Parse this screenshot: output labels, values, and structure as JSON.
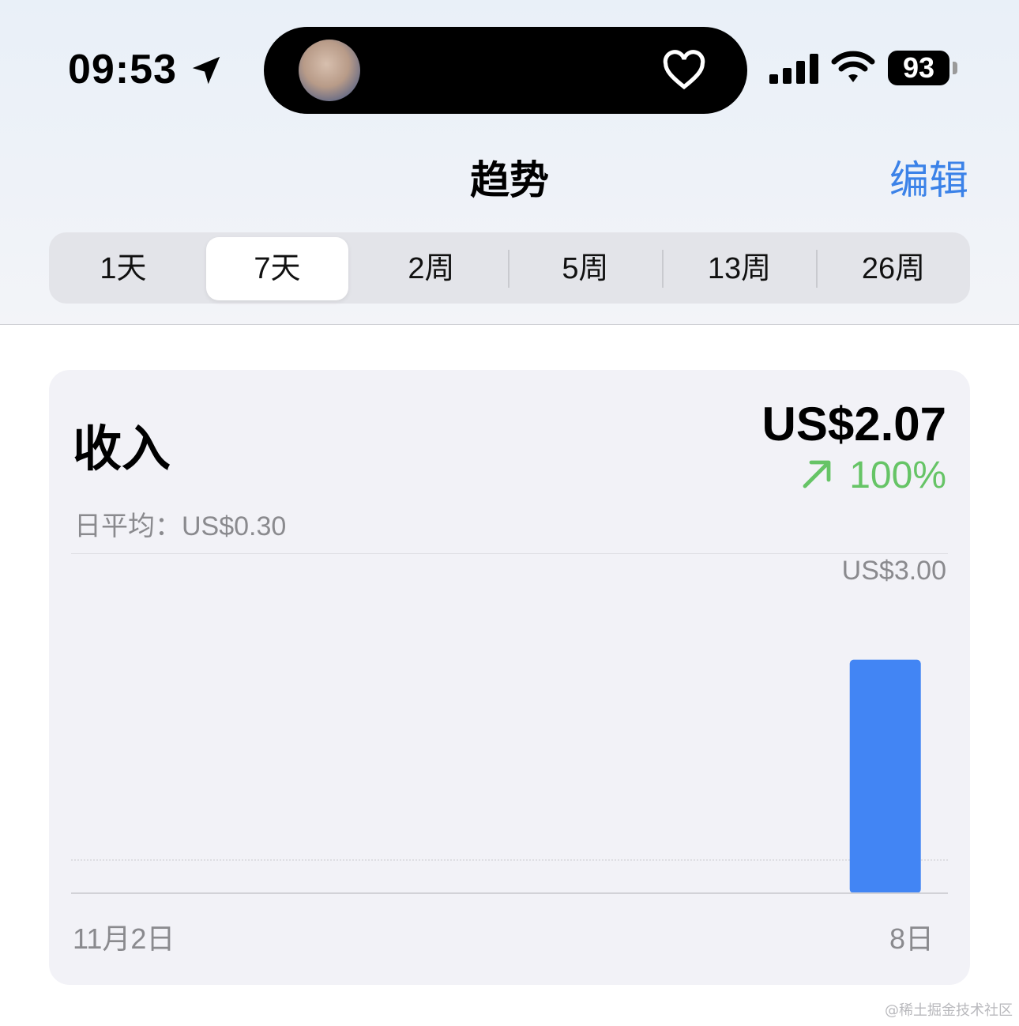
{
  "status_bar": {
    "time": "09:53",
    "battery": "93"
  },
  "nav": {
    "title": "趋势",
    "edit_label": "编辑"
  },
  "segments": [
    {
      "label": "1天",
      "selected": false
    },
    {
      "label": "7天",
      "selected": true
    },
    {
      "label": "2周",
      "selected": false
    },
    {
      "label": "5周",
      "selected": false
    },
    {
      "label": "13周",
      "selected": false
    },
    {
      "label": "26周",
      "selected": false
    }
  ],
  "card": {
    "title": "收入",
    "value": "US$2.07",
    "change": "100%",
    "avg": "日平均：US$0.30"
  },
  "chart_data": {
    "type": "bar",
    "y_max_label": "US$3.00",
    "ylim": [
      0,
      3.0
    ],
    "x_tick_labels": [
      "11月2日",
      "8日"
    ],
    "categories": [
      "11月2日",
      "",
      "",
      "",
      "",
      "",
      "8日"
    ],
    "values": [
      0,
      0,
      0,
      0,
      0,
      0,
      2.07
    ],
    "bar_color": "#4285f4",
    "grid": true
  },
  "watermark": "@稀土掘金技术社区",
  "colors": {
    "accent": "#3b82e8",
    "positive": "#66c466"
  }
}
